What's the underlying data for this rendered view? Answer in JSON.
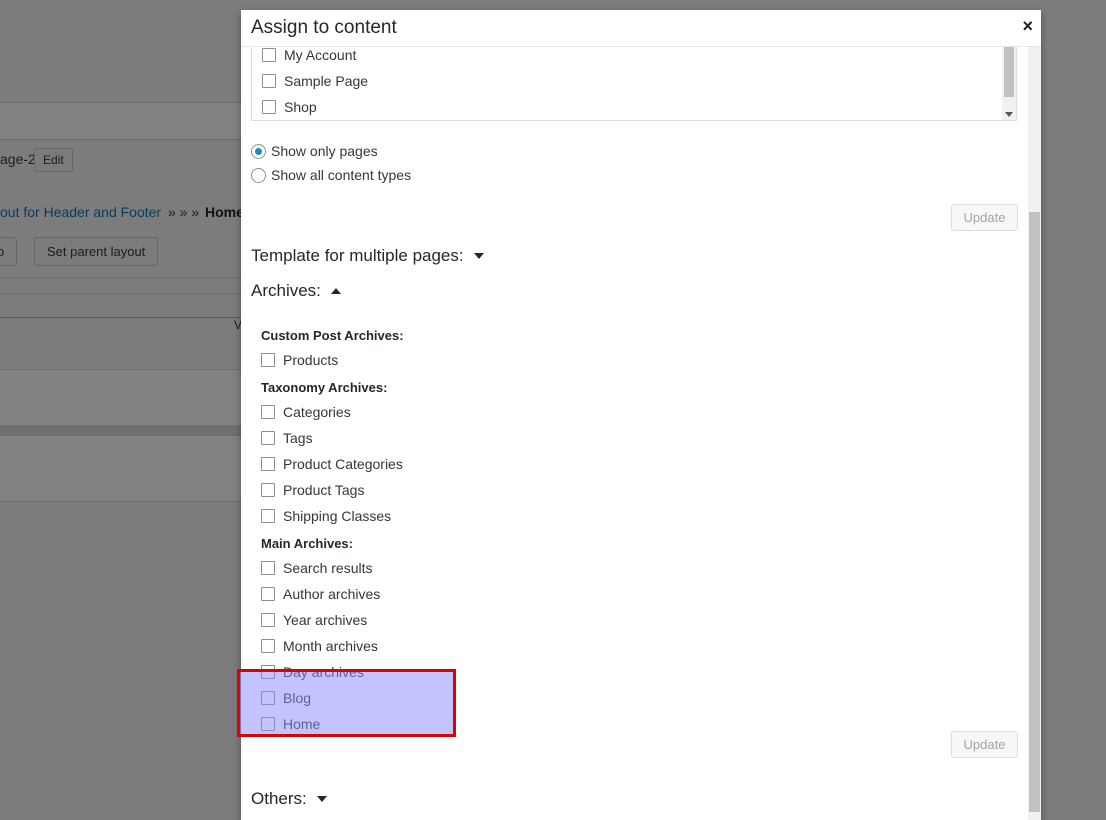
{
  "background": {
    "slug_text": "age-2",
    "edit_button": "Edit",
    "layout_link": "out for Header and Footer",
    "breadcrumb_sep": "» » »",
    "breadcrumb_current": "Home",
    "partial_button": "o",
    "set_parent_button": "Set parent layout",
    "stray_char": "V"
  },
  "modal": {
    "title": "Assign to content",
    "close_icon": "×",
    "pages_list": [
      "My Account",
      "Sample Page",
      "Shop"
    ],
    "radios": [
      {
        "label": "Show only pages",
        "checked": true
      },
      {
        "label": "Show all content types",
        "checked": false
      }
    ],
    "update_label": "Update",
    "template_heading": "Template for multiple pages:",
    "archives_heading": "Archives:",
    "custom_post_label": "Custom Post Archives:",
    "custom_post_items": [
      "Products"
    ],
    "taxonomy_label": "Taxonomy Archives:",
    "taxonomy_items": [
      "Categories",
      "Tags",
      "Product Categories",
      "Product Tags",
      "Shipping Classes"
    ],
    "main_label": "Main Archives:",
    "main_items": [
      "Search results",
      "Author archives",
      "Year archives",
      "Month archives",
      "Day archives",
      "Blog",
      "Home"
    ],
    "others_heading": "Others:"
  },
  "colors": {
    "highlight_fill": "#8787ff",
    "highlight_border": "#e00000",
    "radio_accent": "#1e8cbe"
  }
}
